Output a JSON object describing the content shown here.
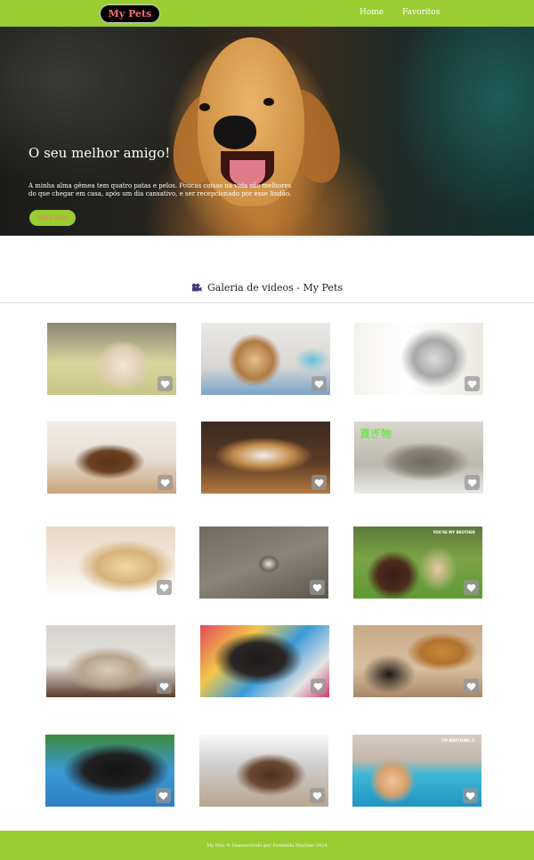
{
  "navbar": {
    "brand": "My Pets",
    "links": [
      {
        "label": "Home"
      },
      {
        "label": "Favoritos"
      }
    ],
    "bg_color": "#9acd32",
    "brand_text_color": "#ff6b6b"
  },
  "hero": {
    "title": "O seu melhor amigo!",
    "text": "A minha alma gêmea tem quatro patas e pelos. Poucas coisas na vida são melhores do que chegar em casa, após um dia cansativo, e ser recepcionado por esse lindão.",
    "button_label": "Saiba Mais"
  },
  "gallery": {
    "title": "Galeria de videos - My Pets",
    "icon": "video-camera-icon",
    "videos": [
      {
        "subject": "pekingese-puppy",
        "icon": "heart-icon"
      },
      {
        "subject": "shih-tzu-puppy",
        "icon": "heart-icon"
      },
      {
        "subject": "chihuahua-puppy",
        "icon": "heart-icon"
      },
      {
        "subject": "dachshund-puppy",
        "icon": "heart-icon"
      },
      {
        "subject": "calico-cat",
        "icon": "heart-icon"
      },
      {
        "subject": "tabby-cat",
        "overlay_text": "貰ぎ物",
        "icon": "heart-icon"
      },
      {
        "subject": "golden-retriever-kittens",
        "icon": "heart-icon"
      },
      {
        "subject": "kitten-on-floor",
        "icon": "heart-icon"
      },
      {
        "subject": "labrador-baby",
        "overlay_text": "YOU'RE MY BROTHER",
        "icon": "heart-icon"
      },
      {
        "subject": "siamese-cat",
        "icon": "heart-icon"
      },
      {
        "subject": "labrador-puppies",
        "icon": "heart-icon"
      },
      {
        "subject": "dachshund-and-cat",
        "icon": "heart-icon"
      },
      {
        "subject": "black-labrador-nursing",
        "icon": "heart-icon"
      },
      {
        "subject": "puppies-on-cushion",
        "icon": "heart-icon"
      },
      {
        "subject": "baby-in-pool",
        "overlay_text": "I'M WATCHING U",
        "icon": "heart-icon"
      }
    ]
  },
  "footer": {
    "text": "My Pets © Desenvolvido por Fernanda Mariano 2024"
  }
}
